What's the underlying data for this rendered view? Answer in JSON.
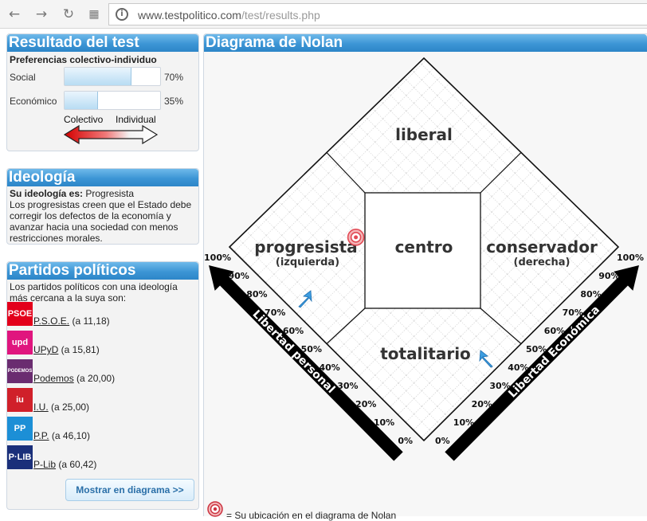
{
  "browser": {
    "url_host": "www.testpolitico.com",
    "url_path": "/test/results.php",
    "back_icon": "arrow-left-icon",
    "forward_icon": "arrow-right-icon",
    "reload_icon": "reload-icon",
    "apps_icon": "apps-grid-icon"
  },
  "result": {
    "title": "Resultado del test",
    "subtitle": "Preferencias colectivo-individuo",
    "bars": [
      {
        "label": "Social",
        "value": 70,
        "display": "70%"
      },
      {
        "label": "Económico",
        "value": 35,
        "display": "35%"
      }
    ],
    "left_label": "Colectivo",
    "right_label": "Individual"
  },
  "ideology": {
    "title": "Ideología",
    "label": "Su ideología es:",
    "value": "Progresista",
    "description": "Los progresistas creen que el Estado debe corregir los defectos de la economía y avanzar hacia una sociedad con menos restricciones morales."
  },
  "parties": {
    "title": "Partidos políticos",
    "intro": "Los partidos políticos con una ideología más cercana a la suya son:",
    "items": [
      {
        "logo": "PSOE",
        "name": "P.S.O.E.",
        "distance": "(a 11,18)",
        "color": "#e3001b"
      },
      {
        "logo": "upd",
        "name": "UPyD",
        "distance": "(a 15,81)",
        "color": "#e0157e"
      },
      {
        "logo": "PODEMOS",
        "name": "Podemos",
        "distance": "(a 20,00)",
        "color": "#6a2c70"
      },
      {
        "logo": "iu",
        "name": "I.U.",
        "distance": "(a 25,00)",
        "color": "#d0202a"
      },
      {
        "logo": "PP",
        "name": "P.P.",
        "distance": "(a 46,10)",
        "color": "#1c8fd6"
      },
      {
        "logo": "P·LIB",
        "name": "P-Lib",
        "distance": "(a 60,42)",
        "color": "#1a2f7a"
      }
    ],
    "button_label": "Mostrar en diagrama >>"
  },
  "nolan": {
    "title": "Diagrama de Nolan",
    "regions": {
      "liberal": "liberal",
      "progresista": "progresista",
      "progresista_sub": "(izquierda)",
      "centro": "centro",
      "conservador": "conservador",
      "conservador_sub": "(derecha)",
      "totalitario": "totalitario"
    },
    "axis_personal": "Libertad personal",
    "axis_economica": "Libertad Económica",
    "ticks": [
      "0%",
      "10%",
      "20%",
      "30%",
      "40%",
      "50%",
      "60%",
      "70%",
      "80%",
      "90%",
      "100%"
    ],
    "user_personal": 70,
    "user_economic": 35,
    "legend": "= Su ubicación en el diagrama de Nolan",
    "accent": "#3c95d5",
    "marker_color": "#e24a55"
  }
}
